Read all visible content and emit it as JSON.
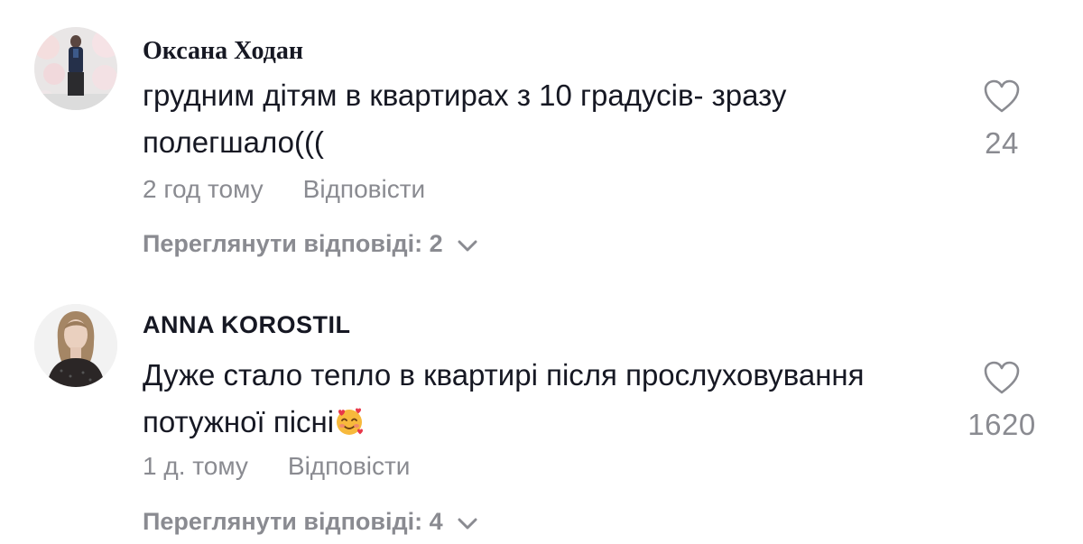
{
  "comments": [
    {
      "username": "Оксана Ходан",
      "text": "грудним дітям в квартирах з 10 градусів- зразу полегшало(((",
      "time": "2 год тому",
      "reply_label": "Відповісти",
      "view_replies": "Переглянути відповіді: 2",
      "likes": "24"
    },
    {
      "username": "ANNA KOROSTIL",
      "text": "Дуже стало тепло в квартирі після прослуховування потужної пісні",
      "emoji": "smiling-face-with-hearts",
      "time": "1 д. тому",
      "reply_label": "Відповісти",
      "view_replies": "Переглянути відповіді: 4",
      "likes": "1620"
    }
  ],
  "colors": {
    "text": "#161823",
    "secondary": "#8a8b91",
    "background": "#ffffff"
  },
  "icons": {
    "like": "heart-outline-icon",
    "expand": "chevron-down-icon"
  }
}
